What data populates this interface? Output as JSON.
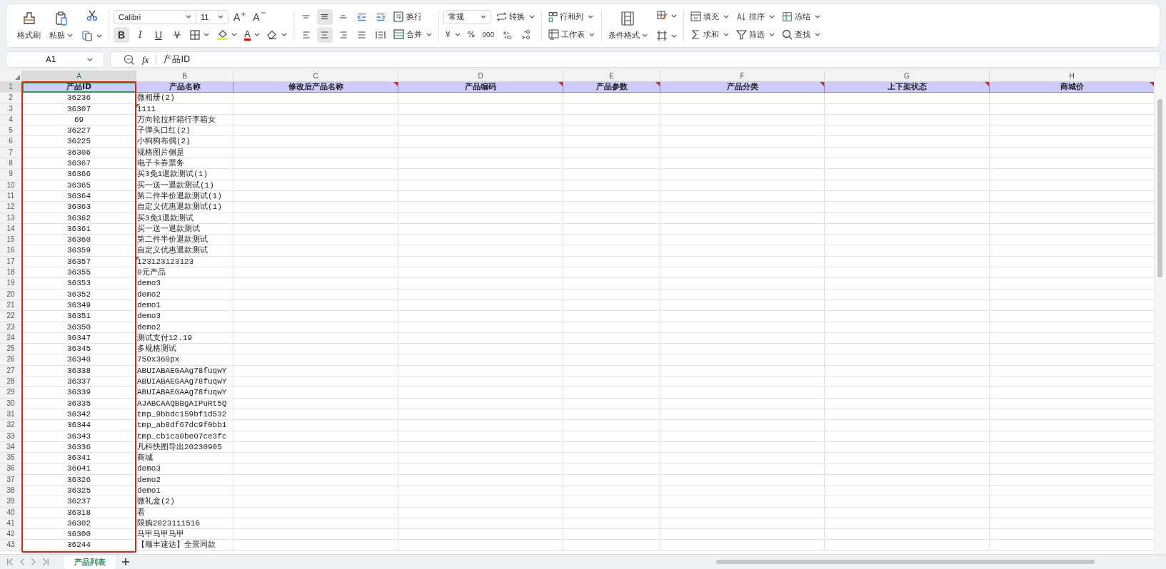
{
  "ribbon": {
    "format_painter": "格式刷",
    "paste": "粘贴",
    "font": "Calibri",
    "size": "11",
    "grow_font": "A",
    "shrink_font": "A",
    "bold": {
      "label": "B",
      "selected": true
    },
    "italic": {
      "label": "I",
      "selected": false
    },
    "underline": {
      "label": "U",
      "selected": false
    },
    "font_color": "A",
    "align_top": {
      "selected": false
    },
    "align_middle": {
      "selected": true
    },
    "align_bottom": {
      "selected": false
    },
    "align_left": {
      "selected": false
    },
    "align_center": {
      "selected": true
    },
    "align_right": {
      "selected": false
    },
    "wrap": "换行",
    "merge": "合并",
    "number_format": "常规",
    "convert": "转换",
    "currency": "¥",
    "percent": "%",
    "thousands": "000",
    "rows_cols": "行和列",
    "worksheet": "工作表",
    "conditional": "条件格式",
    "fill": "填充",
    "sort": "排序",
    "freeze": "冻结",
    "sum": "求和",
    "filter": "筛选",
    "find": "查找"
  },
  "formula_bar": {
    "name_box": "A1",
    "fx": "fx",
    "formula": "产品ID"
  },
  "columns": [
    {
      "letter": "A",
      "header": "产品ID",
      "comment": false,
      "selected": true
    },
    {
      "letter": "B",
      "header": "产品名称",
      "comment": false,
      "selected": false
    },
    {
      "letter": "C",
      "header": "修改后产品名称",
      "comment": true,
      "selected": false
    },
    {
      "letter": "D",
      "header": "产品编码",
      "comment": true,
      "selected": false
    },
    {
      "letter": "E",
      "header": "产品参数",
      "comment": true,
      "selected": false
    },
    {
      "letter": "F",
      "header": "产品分类",
      "comment": true,
      "selected": false
    },
    {
      "letter": "G",
      "header": "上下架状态",
      "comment": true,
      "selected": false
    },
    {
      "letter": "H",
      "header": "商城价",
      "comment": true,
      "selected": false
    }
  ],
  "header_row": {
    "row_number": "1",
    "selected": true
  },
  "rows": [
    {
      "row_number": "2",
      "id": "36236",
      "name": "微相册(2)",
      "text_number": false
    },
    {
      "row_number": "3",
      "id": "36307",
      "name": "1111",
      "text_number": true
    },
    {
      "row_number": "4",
      "id": "69",
      "name": "万向轮拉杆箱行李箱女",
      "text_number": false
    },
    {
      "row_number": "5",
      "id": "36227",
      "name": "子弹头口红(2)",
      "text_number": false
    },
    {
      "row_number": "6",
      "id": "36225",
      "name": "小狗狗布偶(2)",
      "text_number": false
    },
    {
      "row_number": "7",
      "id": "36306",
      "name": "规格图片侧是",
      "text_number": false
    },
    {
      "row_number": "8",
      "id": "36367",
      "name": "电子卡券票务",
      "text_number": false
    },
    {
      "row_number": "9",
      "id": "36366",
      "name": "买3免1退款测试(1)",
      "text_number": false
    },
    {
      "row_number": "10",
      "id": "36365",
      "name": "买一送一退款测试(1)",
      "text_number": false
    },
    {
      "row_number": "11",
      "id": "36364",
      "name": "第二件半价退款测试(1)",
      "text_number": false
    },
    {
      "row_number": "12",
      "id": "36363",
      "name": "自定义优惠退款测试(1)",
      "text_number": false
    },
    {
      "row_number": "13",
      "id": "36362",
      "name": "买3免1退款测试",
      "text_number": false
    },
    {
      "row_number": "14",
      "id": "36361",
      "name": "买一送一退款测试",
      "text_number": false
    },
    {
      "row_number": "15",
      "id": "36360",
      "name": "第二件半价退款测试",
      "text_number": false
    },
    {
      "row_number": "16",
      "id": "36359",
      "name": "自定义优惠退款测试",
      "text_number": false
    },
    {
      "row_number": "17",
      "id": "36357",
      "name": "123123123123",
      "text_number": true
    },
    {
      "row_number": "18",
      "id": "36355",
      "name": "0元产品",
      "text_number": false
    },
    {
      "row_number": "19",
      "id": "36353",
      "name": "demo3",
      "text_number": false
    },
    {
      "row_number": "20",
      "id": "36352",
      "name": "demo2",
      "text_number": false
    },
    {
      "row_number": "21",
      "id": "36349",
      "name": "demo1",
      "text_number": false
    },
    {
      "row_number": "22",
      "id": "36351",
      "name": "demo3",
      "text_number": false
    },
    {
      "row_number": "23",
      "id": "36350",
      "name": "demo2",
      "text_number": false
    },
    {
      "row_number": "24",
      "id": "36347",
      "name": "测试支付12.19",
      "text_number": false
    },
    {
      "row_number": "25",
      "id": "36345",
      "name": "多规格测试",
      "text_number": false
    },
    {
      "row_number": "26",
      "id": "36340",
      "name": "750x360px",
      "text_number": false
    },
    {
      "row_number": "27",
      "id": "36338",
      "name": "ABUIABAEGAAg78fuqwY",
      "text_number": false
    },
    {
      "row_number": "28",
      "id": "36337",
      "name": "ABUIABAEGAAg78fuqwY",
      "text_number": false
    },
    {
      "row_number": "29",
      "id": "36339",
      "name": "ABUIABAEGAAg78fuqwY",
      "text_number": false
    },
    {
      "row_number": "30",
      "id": "36335",
      "name": "AJABCAAQBBgAIPuRt5Q",
      "text_number": false
    },
    {
      "row_number": "31",
      "id": "36342",
      "name": "tmp_9bbdc159bf1d532",
      "text_number": false
    },
    {
      "row_number": "32",
      "id": "36344",
      "name": "tmp_ab8df67dc9f0bb1",
      "text_number": false
    },
    {
      "row_number": "33",
      "id": "36343",
      "name": "tmp_cb1ca0be07ce3fc",
      "text_number": false
    },
    {
      "row_number": "34",
      "id": "36336",
      "name": "凡科快图导出20230905",
      "text_number": false
    },
    {
      "row_number": "35",
      "id": "36341",
      "name": "商城",
      "text_number": false
    },
    {
      "row_number": "36",
      "id": "36041",
      "name": "demo3",
      "text_number": false
    },
    {
      "row_number": "37",
      "id": "36326",
      "name": "demo2",
      "text_number": false
    },
    {
      "row_number": "38",
      "id": "36325",
      "name": "demo1",
      "text_number": false
    },
    {
      "row_number": "39",
      "id": "36237",
      "name": "微礼盒(2)",
      "text_number": false
    },
    {
      "row_number": "40",
      "id": "36318",
      "name": "看",
      "text_number": false
    },
    {
      "row_number": "41",
      "id": "36302",
      "name": "限购2023111516",
      "text_number": false
    },
    {
      "row_number": "42",
      "id": "36300",
      "name": "马甲马甲马甲",
      "text_number": false
    },
    {
      "row_number": "43",
      "id": "36244",
      "name": "【顺丰速达】全景同款",
      "text_number": false
    }
  ],
  "sheet_tabs": [
    {
      "label": "产品列表",
      "selected": true
    }
  ]
}
